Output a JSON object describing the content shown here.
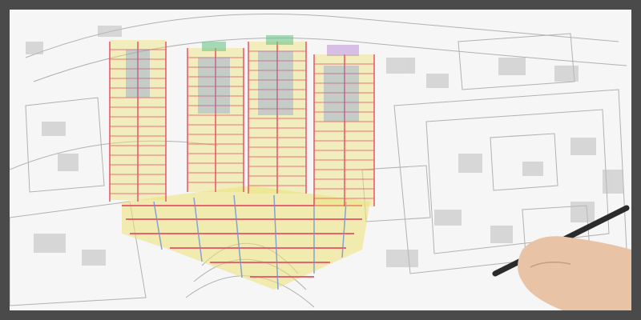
{
  "scene": {
    "subject": "",
    "colors": {
      "frame_border": "#4a4a4a",
      "paper": "#f6f6f6",
      "plan_lines": "#9a9a9a",
      "plan_fill": "#bdbdbd",
      "beam_red": "#e8546a",
      "beam_yellow": "#ece276",
      "beam_blue": "#6f8fd6",
      "beam_green": "#6fc48a",
      "beam_purple": "#b07ad1",
      "skin": "#e9c3a6",
      "pen": "#2b2b2b"
    }
  }
}
